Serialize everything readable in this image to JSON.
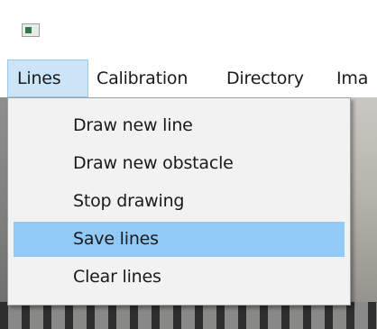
{
  "menubar": {
    "items": [
      {
        "label": "Lines"
      },
      {
        "label": "Calibration"
      },
      {
        "label": "Directory"
      },
      {
        "label": "Ima"
      }
    ]
  },
  "dropdown": {
    "parent": "Lines",
    "items": [
      {
        "label": "Draw new line"
      },
      {
        "label": "Draw new obstacle"
      },
      {
        "label": "Stop drawing"
      },
      {
        "label": "Save lines",
        "highlighted": true
      },
      {
        "label": "Clear lines"
      }
    ]
  },
  "colors": {
    "menu_active_bg": "#cce4f7",
    "menu_item_highlight": "#91c9f7",
    "dropdown_bg": "#f2f2f2"
  }
}
